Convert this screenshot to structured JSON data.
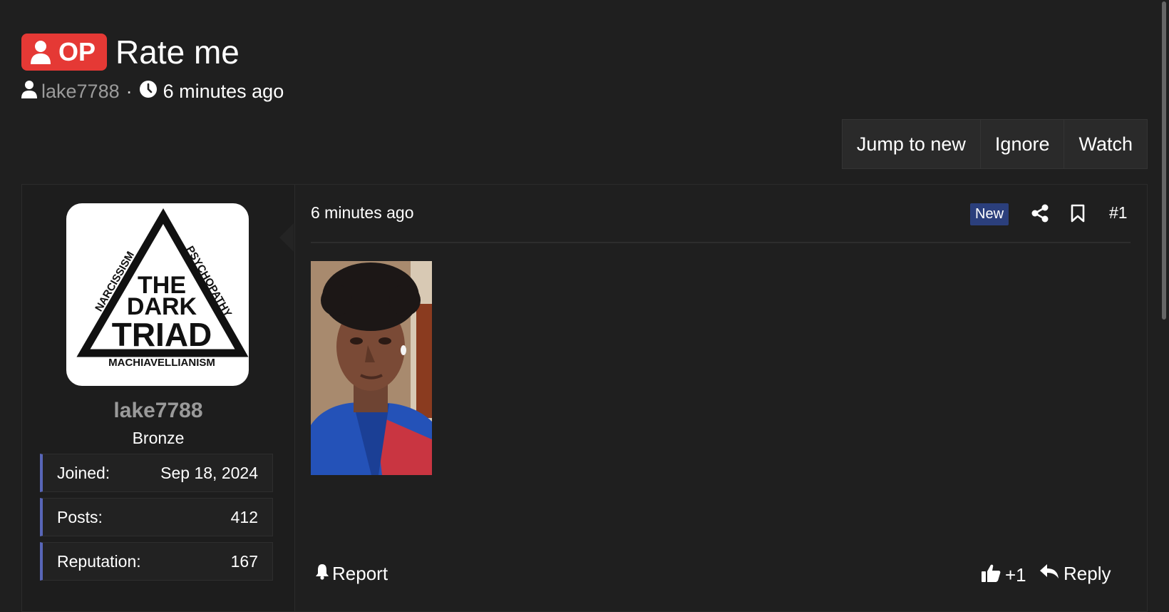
{
  "thread": {
    "prefix": "OP",
    "title": "Rate me",
    "author": "lake7788",
    "separator": "·",
    "time": "6 minutes ago"
  },
  "actions": {
    "jump": "Jump to new",
    "ignore": "Ignore",
    "watch": "Watch"
  },
  "user": {
    "name": "lake7788",
    "title": "Bronze",
    "avatar_words": [
      "THE",
      "DARK",
      "TRIAD",
      "NARCISSISM",
      "PSYCHOPATHY",
      "MACHIAVELLIANISM"
    ],
    "stats": [
      {
        "label": "Joined:",
        "value": "Sep 18, 2024"
      },
      {
        "label": "Posts:",
        "value": "412"
      },
      {
        "label": "Reputation:",
        "value": "167"
      }
    ]
  },
  "post": {
    "time": "6 minutes ago",
    "badge": "New",
    "number": "#1",
    "report": "Report",
    "likes": "+1",
    "reply": "Reply"
  },
  "colors": {
    "background": "#1f1f1f",
    "op_badge": "#e53935",
    "new_badge": "#2b3f7c",
    "stat_accent": "#5866b8"
  },
  "icons": [
    "user-icon",
    "clock-icon",
    "share-icon",
    "bookmark-icon",
    "bell-icon",
    "thumbs-up-icon",
    "reply-icon"
  ]
}
